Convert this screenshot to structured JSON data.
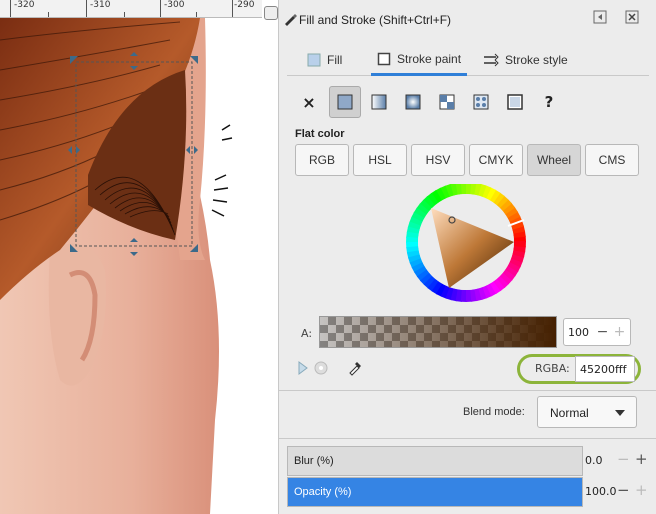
{
  "ruler": {
    "ticks": [
      "-320",
      "-310",
      "-300",
      "-290"
    ]
  },
  "window": {
    "title": "Fill and Stroke (Shift+Ctrl+F)"
  },
  "tabs": [
    {
      "label": "Fill",
      "icon": "fill-icon"
    },
    {
      "label": "Stroke paint",
      "icon": "stroke-paint-icon",
      "active": true
    },
    {
      "label": "Stroke style",
      "icon": "stroke-style-icon"
    }
  ],
  "paint_types": [
    {
      "name": "no-paint",
      "glyph": "×"
    },
    {
      "name": "flat-color",
      "selected": true
    },
    {
      "name": "linear-gradient"
    },
    {
      "name": "radial-gradient"
    },
    {
      "name": "mesh-gradient"
    },
    {
      "name": "pattern"
    },
    {
      "name": "swatch"
    },
    {
      "name": "unset",
      "glyph": "?"
    }
  ],
  "flat_color_label": "Flat color",
  "color_modes": [
    "RGB",
    "HSL",
    "HSV",
    "CMYK",
    "Wheel",
    "CMS"
  ],
  "selected_mode": "Wheel",
  "alpha": {
    "label": "A:",
    "value": "100",
    "minus": "−",
    "plus": "+"
  },
  "rgba": {
    "label": "RGBA:",
    "value": "45200fff"
  },
  "blend": {
    "label": "Blend mode:",
    "value": "Normal"
  },
  "blur": {
    "label": "Blur (%)",
    "value": "0.0",
    "level": 0
  },
  "opacity": {
    "label": "Opacity (%)",
    "value": "100.0",
    "level": 1
  },
  "colors": {
    "accent": "#3584e4",
    "current_color": "#452000",
    "highlight_ring": "#8cb43a"
  }
}
